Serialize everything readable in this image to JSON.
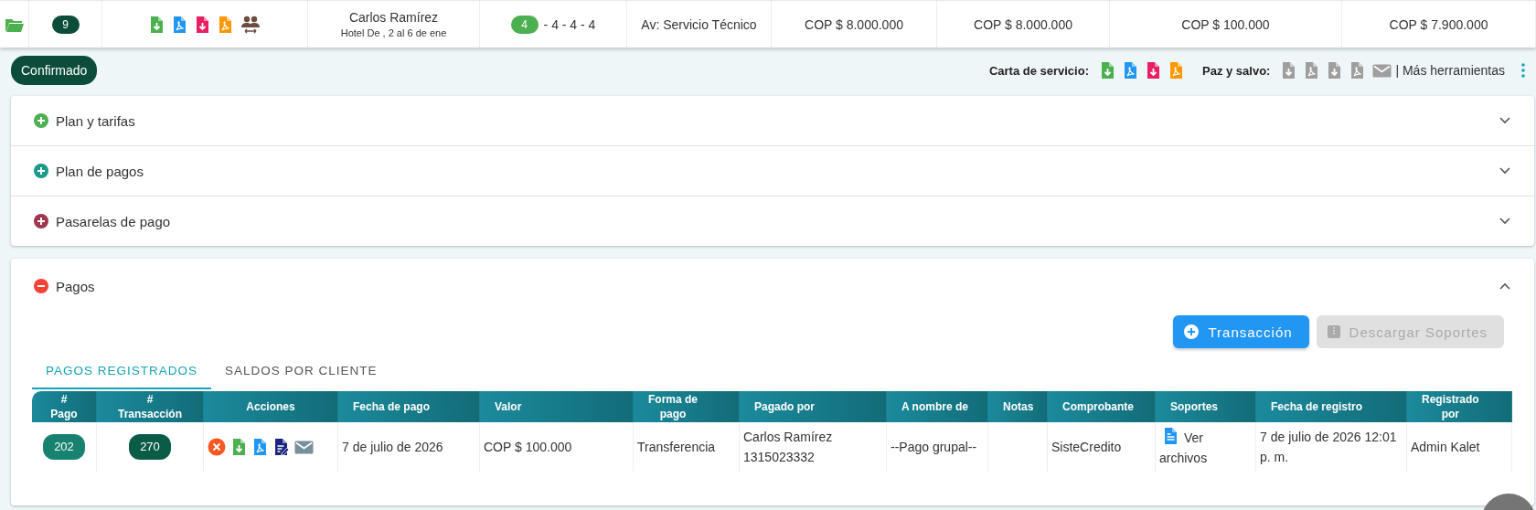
{
  "summary_row": {
    "count": "9",
    "icons": [
      {
        "kind": "download",
        "color": "#4caf50"
      },
      {
        "kind": "pdf",
        "color": "#2196f3"
      },
      {
        "kind": "download",
        "color": "#e91e63"
      },
      {
        "kind": "pdf",
        "color": "#ff9800"
      },
      {
        "kind": "group",
        "color": "#6d4c41"
      }
    ],
    "client_name": "Carlos Ramírez",
    "client_detail": "Hotel De , 2 al 6 de ene",
    "rooms_badge": "4",
    "rooms_rest": "- 4 - 4 - 4",
    "advisor": "Av: Servicio Técnico",
    "amounts": [
      "COP $ 8.000.000",
      "COP $ 8.000.000",
      "COP $ 100.000",
      "COP $ 7.900.000"
    ]
  },
  "status": "Confirmado",
  "toolbar": {
    "service_label": "Carta de servicio:",
    "service_icons": [
      {
        "kind": "download",
        "color": "#4caf50"
      },
      {
        "kind": "pdf",
        "color": "#2196f3"
      },
      {
        "kind": "download",
        "color": "#e91e63"
      },
      {
        "kind": "pdf",
        "color": "#ff9800"
      }
    ],
    "clearance_label": "Paz y salvo:",
    "clearance_icons": [
      {
        "kind": "download",
        "color": "#9e9e9e"
      },
      {
        "kind": "pdf",
        "color": "#9e9e9e"
      },
      {
        "kind": "download",
        "color": "#9e9e9e"
      },
      {
        "kind": "pdf",
        "color": "#9e9e9e"
      },
      {
        "kind": "mail",
        "color": "#9e9e9e"
      }
    ],
    "more_tools": "| Más herramientas"
  },
  "sections": [
    {
      "title": "Plan y tarifas",
      "expanded": false,
      "color": "#4caf50"
    },
    {
      "title": "Plan de pagos",
      "expanded": false,
      "color": "#1a9a8a"
    },
    {
      "title": "Pasarelas de pago",
      "expanded": false,
      "color": "#a0364e"
    }
  ],
  "payments": {
    "title": "Pagos",
    "expanded": true,
    "color": "#f44336",
    "buttons": [
      {
        "label": "Transacción",
        "disabled": false
      },
      {
        "label": "Descargar Soportes",
        "disabled": true
      }
    ],
    "tabs": [
      {
        "label": "PAGOS REGISTRADOS",
        "selected": true
      },
      {
        "label": "SALDOS POR CLIENTE",
        "selected": false
      }
    ],
    "table": {
      "columns": [
        "#\nPago",
        "#\nTransacción",
        "Acciones",
        "Fecha de pago",
        "Valor",
        "Forma de\npago",
        "Pagado por",
        "A nombre de",
        "Notas",
        "Comprobante",
        "Soportes",
        "Fecha de registro",
        "Registrado\npor"
      ],
      "rows": [
        {
          "cells": [
            {
              "kind": "pill",
              "text": "202",
              "color": "#17826f"
            },
            {
              "kind": "pill",
              "text": "270",
              "color": "#0b5c47"
            },
            {
              "kind": "actions",
              "icons": [
                {
                  "kind": "cancel",
                  "color": "#ff5722"
                },
                {
                  "kind": "download",
                  "color": "#4caf50"
                },
                {
                  "kind": "pdf",
                  "color": "#2196f3"
                },
                {
                  "kind": "edit",
                  "color": "#1a237e"
                },
                {
                  "kind": "mail",
                  "color": "#78909c"
                }
              ]
            },
            {
              "kind": "text",
              "text": "7 de julio de 2026"
            },
            {
              "kind": "text",
              "text": "COP $ 100.000"
            },
            {
              "kind": "text",
              "text": "Transferencia"
            },
            {
              "kind": "text",
              "text": "Carlos Ramírez 1315023332"
            },
            {
              "kind": "text",
              "text": "--Pago grupal--"
            },
            {
              "kind": "empty"
            },
            {
              "kind": "text",
              "text": "SisteCredito"
            },
            {
              "kind": "file",
              "text": "Ver archivos"
            },
            {
              "kind": "text",
              "text": "7 de julio de 2026 12:01 p. m."
            },
            {
              "kind": "text",
              "text": "Admin Kalet"
            }
          ]
        }
      ]
    }
  }
}
